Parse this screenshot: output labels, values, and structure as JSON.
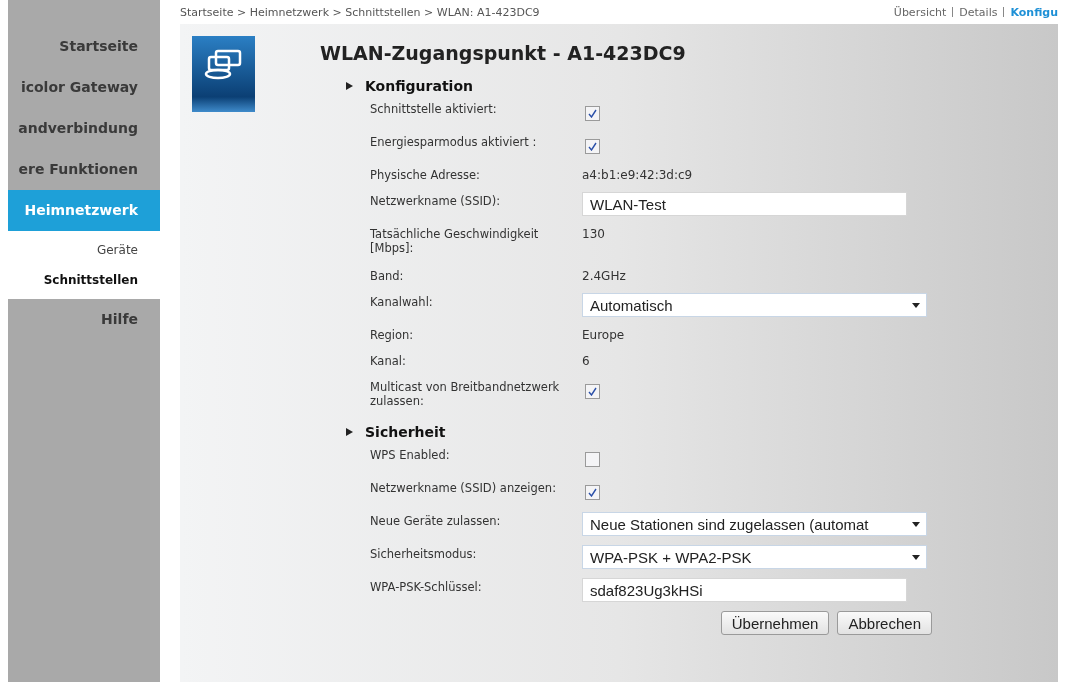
{
  "breadcrumb": "Startseite > Heimnetzwerk > Schnittstellen > WLAN: A1-423DC9",
  "view_links": [
    {
      "label": "Übersicht",
      "selected": false
    },
    {
      "label": "Details",
      "selected": false
    },
    {
      "label": "Konfigu",
      "selected": true
    }
  ],
  "sidebar": {
    "items": [
      {
        "label": "Startseite",
        "selected": false
      },
      {
        "label": "icolor Gateway",
        "selected": false
      },
      {
        "label": "andverbindung",
        "selected": false
      },
      {
        "label": "ere Funktionen",
        "selected": false
      },
      {
        "label": "Heimnetzwerk",
        "selected": true,
        "children": [
          {
            "label": "Geräte",
            "selected": false
          },
          {
            "label": "Schnittstellen",
            "selected": true
          }
        ]
      },
      {
        "label": "Hilfe",
        "selected": false
      }
    ]
  },
  "title": "WLAN-Zugangspunkt - A1-423DC9",
  "sections": [
    {
      "title": "Konfiguration",
      "rows": [
        {
          "kind": "checkbox",
          "label": "Schnittstelle aktiviert:",
          "checked": true
        },
        {
          "kind": "checkbox",
          "label": "Energiesparmodus aktiviert :",
          "checked": true
        },
        {
          "kind": "text",
          "label": "Physische Adresse:",
          "value": "a4:b1:e9:42:3d:c9"
        },
        {
          "kind": "input",
          "label": "Netzwerkname (SSID):",
          "value": "WLAN-Test"
        },
        {
          "kind": "text",
          "label": "Tatsächliche Geschwindigkeit [Mbps]:",
          "value": "130"
        },
        {
          "kind": "text",
          "label": "Band:",
          "value": "2.4GHz"
        },
        {
          "kind": "select",
          "label": "Kanalwahl:",
          "value": "Automatisch"
        },
        {
          "kind": "text",
          "label": "Region:",
          "value": "Europe"
        },
        {
          "kind": "text",
          "label": "Kanal:",
          "value": "6"
        },
        {
          "kind": "checkbox",
          "label": "Multicast von Breitbandnetzwerk zulassen:",
          "checked": true
        }
      ]
    },
    {
      "title": "Sicherheit",
      "rows": [
        {
          "kind": "checkbox",
          "label": "WPS Enabled:",
          "checked": false
        },
        {
          "kind": "checkbox",
          "label": "Netzwerkname (SSID) anzeigen:",
          "checked": true
        },
        {
          "kind": "select",
          "label": "Neue Geräte zulassen:",
          "value": "Neue Stationen sind zugelassen (automat"
        },
        {
          "kind": "select",
          "label": "Sicherheitsmodus:",
          "value": "WPA-PSK + WPA2-PSK"
        },
        {
          "kind": "input",
          "label": "WPA-PSK-Schlüssel:",
          "value": "sdaf823Ug3kHSi"
        }
      ]
    }
  ],
  "buttons": [
    "Übernehmen",
    "Abbrechen"
  ]
}
